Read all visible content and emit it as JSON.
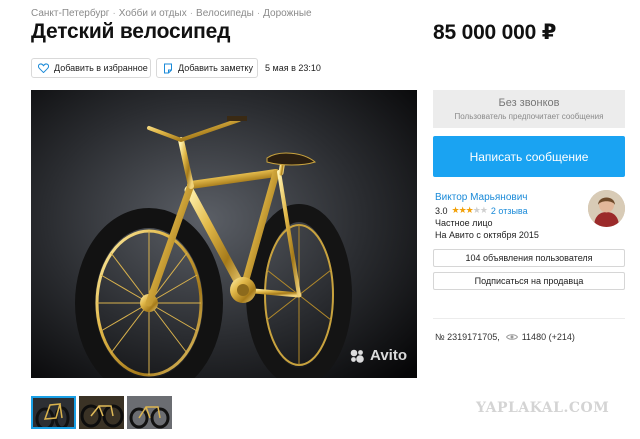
{
  "breadcrumbs": [
    "Санкт-Петербург",
    "Хобби и отдых",
    "Велосипеды",
    "Дорожные"
  ],
  "listing": {
    "title": "Детский велосипед",
    "price": "85 000 000 ₽",
    "date": "5 мая в 23:10",
    "id_text": "№ 2319171705,",
    "views_text": "11480 (+214)"
  },
  "actions": {
    "favorite_label": "Добавить в избранное",
    "note_label": "Добавить заметку"
  },
  "photo": {
    "watermark": "Avito"
  },
  "contact": {
    "no_calls_title": "Без звонков",
    "no_calls_subtitle": "Пользователь предпочитает сообщения",
    "write_button": "Написать сообщение"
  },
  "seller": {
    "name": "Виктор Марьянович",
    "rating_value": "3.0",
    "rating_stars": 3,
    "rating_max": 5,
    "reviews_link": "2 отзыва",
    "type": "Частное лицо",
    "since": "На Авито с октября 2015",
    "ads_button": "104 объявления пользователя",
    "subscribe_button": "Подписаться на продавца"
  },
  "site_watermark": "YAPLAKAL.COM",
  "colors": {
    "accent": "#1aa3f2",
    "link": "#1a8ad8",
    "star": "#f2a007",
    "thumb_active": "#1aa0e6"
  }
}
